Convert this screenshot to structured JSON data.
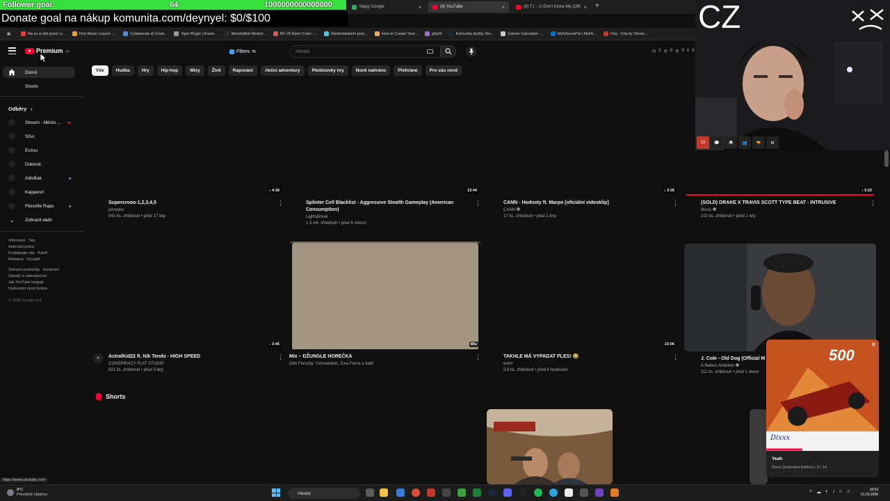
{
  "browser": {
    "tabs": [
      {
        "label": "",
        "active": false
      },
      {
        "label": "Mapy Google",
        "active": false
      },
      {
        "label": "(9) YouTube",
        "active": true
      },
      {
        "label": "(9) T.I. - U Don't Know Me (Offi",
        "active": false
      }
    ],
    "new_tab": "+",
    "bookmarks": [
      "Na co si dát pozor u...",
      "First Music Lesson -...",
      "Collaborate & Creat...",
      "Tape Plugin | Kramr...",
      "MondoMod Moduli...",
      "RC-20 Retro Color -...",
      "Administrativní prac...",
      "How to Create Your...",
      "ghjshf",
      "Komunita služby Ste...",
      "Calorie Calculator -...",
      "MyFitnessPal | MyFit...",
      "Cha - Cha by Simon..."
    ],
    "status_url": "https://www.youtube.com"
  },
  "overlay": {
    "goal_label": "Follower goal:",
    "goal_count": "64",
    "goal_target": "1000000000000000",
    "donate": "Donate goal na nákup komunita.com/deynyel: $0/$100",
    "cam_label": "CZ",
    "badges": [
      "18",
      "💬",
      "🕷",
      "👥",
      "🔫",
      "⚙"
    ]
  },
  "header": {
    "logo_text": "Premium",
    "logo_country": "CZ",
    "filters_label": "Filters",
    "search_placeholder": "Hledat",
    "stats": [
      "1",
      "0",
      "0",
      "0"
    ]
  },
  "sidebar": {
    "main": [
      {
        "label": "Domů",
        "icon": "home-icon"
      },
      {
        "label": "Shorts",
        "icon": "shorts-icon"
      }
    ],
    "subs_heading": "Odběry",
    "subscriptions": [
      {
        "label": "Stream - Město ...",
        "indicator": "live"
      },
      {
        "label": "S0ur",
        "indicator": "none"
      },
      {
        "label": "Evzuu",
        "indicator": "none"
      },
      {
        "label": "Duklock",
        "indicator": "none"
      },
      {
        "label": "AdisBak",
        "indicator": "dot"
      },
      {
        "label": "Kappenzi",
        "indicator": "none"
      },
      {
        "label": "Filosofie Rapu",
        "indicator": "dot"
      }
    ],
    "show_more": "Zobrazit další",
    "footer1": [
      "Informace",
      "Tisk",
      "Autorská práva",
      "Kontaktujte nás",
      "Autoři",
      "Reklama",
      "Vývojáři"
    ],
    "footer2": [
      "Smluvní podmínky",
      "Soukromí",
      "Zásady a zabezpečení",
      "Jak YouTube funguje",
      "Vyzkoušet nové funkce"
    ],
    "copyright": "© 2026 Google LLC"
  },
  "chips": [
    "Vše",
    "Hudba",
    "Hry",
    "Hip-hop",
    "Mixy",
    "Živě",
    "Rapování",
    "Akční adventury",
    "Plošinovky hry",
    "Nově nahráno",
    "Přehráno",
    "Pro vás nové"
  ],
  "videos": [
    {
      "title": "Supercrooo-1,2,3,4,5",
      "channel": "jerseyko",
      "stats": "943 tis. zhlédnutí • před 17 lety",
      "duration": "♪ 4:18",
      "verified": false
    },
    {
      "title": "Splinter Cell Blacklist - Aggressive Stealth Gameplay (American Consumption)",
      "channel": "LightsBreak",
      "stats": "1,3 mil. zhlédnutí • před 9 měsíci",
      "duration": "13:44",
      "verified": false
    },
    {
      "title": "CANN - Hodnoty ft. Marpo [oficiální videoklip]",
      "channel": "CANN",
      "stats": "17 tis. zhlédnutí • před 2 dny",
      "duration": "♪ 3:26",
      "verified": true
    },
    {
      "title": "(SOLD) DRAKE X TRAVIS SCOTT TYPE BEAT - INTRUSIVE",
      "channel": "lllouis",
      "stats": "102 tis. zhlédnutí • před 2 lety",
      "duration": "♪ 3:22",
      "verified": true
    },
    {
      "title": "AstralKid22 ft. Nik Tendo - HIGH SPEED",
      "channel": "CONSPIRACY FLAT STUDIO",
      "stats": "631 tis. zhlédnutí • před 3 lety",
      "duration": "♪ 3:45",
      "verified": false
    },
    {
      "title": "Mix – DŽUNGLE HOREČKA",
      "channel": "Otto Ferocity, Yzomandias, Ewa Farna a další",
      "stats": "",
      "duration": "Mix",
      "verified": false
    },
    {
      "title": "TAKHLE MÁ VYPADAT PLES! 😂",
      "channel": "erem",
      "stats": "5,8 tis. zhlédnutí • před 6 hodinami",
      "duration": "23:06",
      "verified": false
    },
    {
      "title": "J. Cole - Old Dog (Official M",
      "channel": "A Ballers Ambition",
      "stats": "111 tis. zhlédnutí • před 1 dnem",
      "duration": "",
      "verified": true
    }
  ],
  "shorts_heading": "Shorts",
  "miniplayer": {
    "title": "Yeah",
    "subtitle": "Dixxx (Extended Edition) • 9 / 14",
    "art_brand": "Dixxx"
  },
  "taskbar": {
    "temp": "8°C",
    "weather": "Převážně oblačno",
    "search": "Hledat",
    "time": "18:53",
    "date": "01.03.2026"
  },
  "colors": {
    "accent": "#ff0033",
    "goal_bar": "#35e13a",
    "bg": "#0f0f0f"
  }
}
